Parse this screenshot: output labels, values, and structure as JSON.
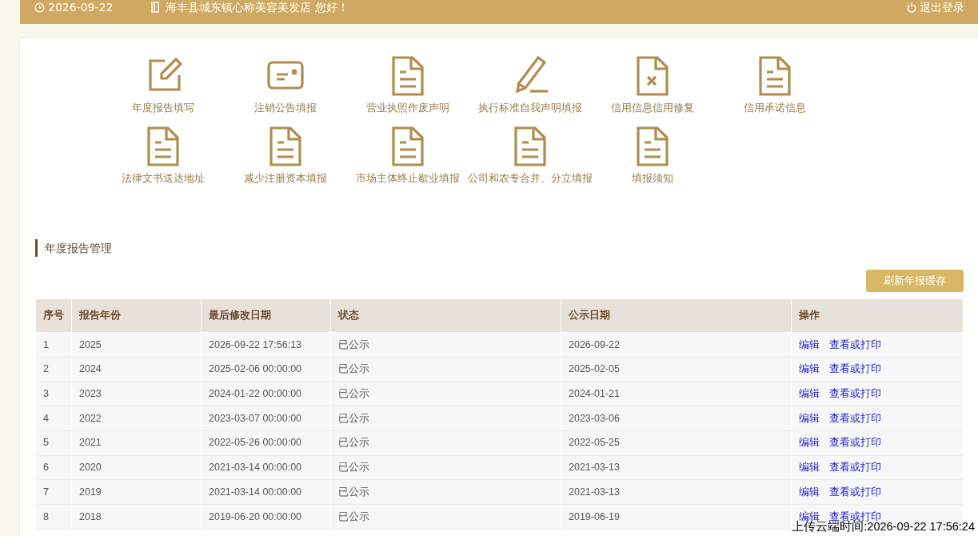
{
  "header": {
    "date": "2026-09-22",
    "greeting": "海丰县城东镇心称美容美发店 您好！",
    "logout": "退出登录"
  },
  "shortcuts": [
    {
      "kind": "edit",
      "label": "年度报告填写"
    },
    {
      "kind": "card",
      "label": "注销公告填报"
    },
    {
      "kind": "doc",
      "label": "营业执照作废声明"
    },
    {
      "kind": "pencil",
      "label": "执行标准自我声明填报"
    },
    {
      "kind": "docx",
      "label": "信用信息信用修复"
    },
    {
      "kind": "doc",
      "label": "信用承诺信息"
    },
    {
      "kind": "doc",
      "label": "法律文书送达地址"
    },
    {
      "kind": "doc",
      "label": "减少注册资本填报"
    },
    {
      "kind": "doc",
      "label": "市场主体终止歇业填报"
    },
    {
      "kind": "doc",
      "label": "公司和农专合并、分立填报"
    },
    {
      "kind": "doc",
      "label": "填报须知"
    }
  ],
  "section_title": "年度报告管理",
  "refresh_button": "刷新年报缓存",
  "table": {
    "columns": [
      "序号",
      "报告年份",
      "最后修改日期",
      "状态",
      "公示日期",
      "操作"
    ],
    "rows": [
      {
        "cells": [
          "1",
          "2025",
          "2026-09-22 17:56:13",
          "已公示",
          "2026-09-22"
        ],
        "actions": [
          "编辑",
          "查看或打印"
        ]
      },
      {
        "cells": [
          "2",
          "2024",
          "2025-02-06 00:00:00",
          "已公示",
          "2025-02-05"
        ],
        "actions": [
          "编辑",
          "查看或打印"
        ]
      },
      {
        "cells": [
          "3",
          "2023",
          "2024-01-22 00:00:00",
          "已公示",
          "2024-01-21"
        ],
        "actions": [
          "编辑",
          "查看或打印"
        ]
      },
      {
        "cells": [
          "4",
          "2022",
          "2023-03-07 00:00:00",
          "已公示",
          "2023-03-06"
        ],
        "actions": [
          "编辑",
          "查看或打印"
        ]
      },
      {
        "cells": [
          "5",
          "2021",
          "2022-05-26 00:00:00",
          "已公示",
          "2022-05-25"
        ],
        "actions": [
          "编辑",
          "查看或打印"
        ]
      },
      {
        "cells": [
          "6",
          "2020",
          "2021-03-14 00:00:00",
          "已公示",
          "2021-03-13"
        ],
        "actions": [
          "编辑",
          "查看或打印"
        ]
      },
      {
        "cells": [
          "7",
          "2019",
          "2021-03-14 00:00:00",
          "已公示",
          "2021-03-13"
        ],
        "actions": [
          "编辑",
          "查看或打印"
        ]
      },
      {
        "cells": [
          "8",
          "2018",
          "2019-06-20 00:00:00",
          "已公示",
          "2019-06-19"
        ],
        "actions": [
          "编辑",
          "查看或打印"
        ]
      }
    ]
  },
  "upload_stamp": "上传云端时间:2026-09-22 17:56:24"
}
